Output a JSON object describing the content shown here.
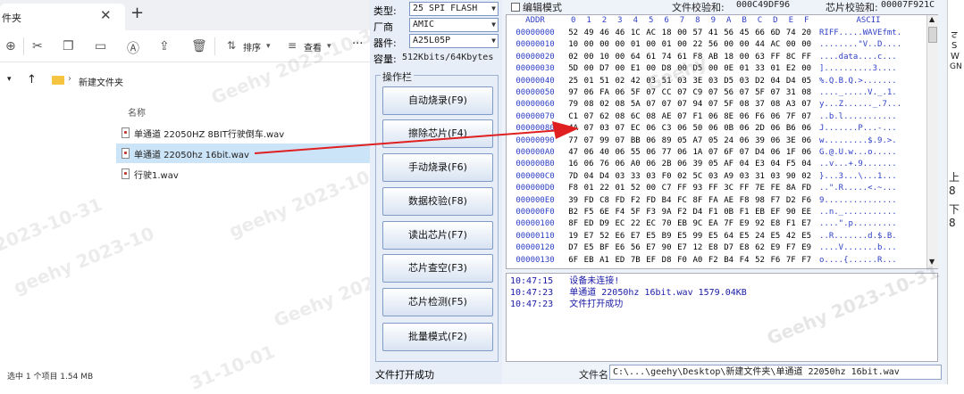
{
  "explorer": {
    "tab_title": "件夹",
    "tab_close": "✕",
    "tab_add": "+",
    "toolbar": {
      "sort_label": "排序",
      "view_label": "查看",
      "more": "···"
    },
    "address": {
      "folder": "新建文件夹"
    },
    "column_header": "名称",
    "files": [
      {
        "name": "单通道 22050HZ 8BIT行驶倒车.wav",
        "selected": false
      },
      {
        "name": "单通道 22050hz 16bit.wav",
        "selected": true
      },
      {
        "name": "行驶1.wav",
        "selected": false
      }
    ],
    "status": "选中 1 个项目  1.54 MB",
    "watermarks": [
      "Geehy 2023-10-31",
      "geehy 2023-10-31",
      "2023-10-31",
      "geehy 2023-10",
      "Geehy 2023-10-31",
      "31-10-01"
    ]
  },
  "programmer": {
    "type_label": "类型:",
    "type_value": "25 SPI FLASH",
    "vendor_label": "厂商",
    "vendor_value": "AMIC",
    "device_label": "器件:",
    "device_value": "A25L05P",
    "capacity_label": "容量:",
    "capacity_value": "512Kbits/64Kbytes",
    "group_title": "操作栏",
    "buttons": [
      "自动烧录(F9)",
      "擦除芯片(F4)",
      "手动烧录(F6)",
      "数据校验(F8)",
      "读出芯片(F7)",
      "芯片查空(F3)",
      "芯片检测(F5)",
      "批量模式(F2)"
    ],
    "edit_mode_label": "编辑模式",
    "file_checksum_label": "文件校验和:",
    "file_checksum_value": "000C49DF96",
    "chip_checksum_label": "芯片校验和:",
    "chip_checksum_value": "00007F921C",
    "hex_header": {
      "addr": "ADDR",
      "cols": [
        "0",
        "1",
        "2",
        "3",
        "4",
        "5",
        "6",
        "7",
        "8",
        "9",
        "A",
        "B",
        "C",
        "D",
        "E",
        "F"
      ],
      "ascii": "ASCII"
    },
    "hex_rows": [
      {
        "addr": "00000000",
        "bytes": [
          "52",
          "49",
          "46",
          "46",
          "1C",
          "AC",
          "18",
          "00",
          "57",
          "41",
          "56",
          "45",
          "66",
          "6D",
          "74",
          "20"
        ],
        "ascii": "RIFF.....WAVEfmt."
      },
      {
        "addr": "00000010",
        "bytes": [
          "10",
          "00",
          "00",
          "00",
          "01",
          "00",
          "01",
          "00",
          "22",
          "56",
          "00",
          "00",
          "44",
          "AC",
          "00",
          "00"
        ],
        "ascii": "........\"V..D...."
      },
      {
        "addr": "00000020",
        "bytes": [
          "02",
          "00",
          "10",
          "00",
          "64",
          "61",
          "74",
          "61",
          "F8",
          "AB",
          "18",
          "00",
          "63",
          "FF",
          "8C",
          "FF"
        ],
        "ascii": "....data....c..."
      },
      {
        "addr": "00000030",
        "bytes": [
          "5D",
          "00",
          "D7",
          "00",
          "E1",
          "00",
          "D8",
          "00",
          "D5",
          "00",
          "0E",
          "01",
          "33",
          "01",
          "E2",
          "00"
        ],
        "ascii": "]..........3...."
      },
      {
        "addr": "00000040",
        "bytes": [
          "25",
          "01",
          "51",
          "02",
          "42",
          "03",
          "51",
          "03",
          "3E",
          "03",
          "D5",
          "03",
          "D2",
          "04",
          "D4",
          "05"
        ],
        "ascii": "%.Q.B.Q.>......."
      },
      {
        "addr": "00000050",
        "bytes": [
          "97",
          "06",
          "FA",
          "06",
          "5F",
          "07",
          "CC",
          "07",
          "C9",
          "07",
          "56",
          "07",
          "5F",
          "07",
          "31",
          "08"
        ],
        "ascii": "...._.....V._.1."
      },
      {
        "addr": "00000060",
        "bytes": [
          "79",
          "08",
          "02",
          "08",
          "5A",
          "07",
          "07",
          "07",
          "94",
          "07",
          "5F",
          "08",
          "37",
          "08",
          "A3",
          "07"
        ],
        "ascii": "y...Z......_.7..."
      },
      {
        "addr": "00000070",
        "bytes": [
          "C1",
          "07",
          "62",
          "08",
          "6C",
          "08",
          "AE",
          "07",
          "F1",
          "06",
          "8E",
          "06",
          "F6",
          "06",
          "7F",
          "07"
        ],
        "ascii": "..b.l..........."
      },
      {
        "addr": "00000080",
        "bytes": [
          "4A",
          "07",
          "03",
          "07",
          "EC",
          "06",
          "C3",
          "06",
          "50",
          "06",
          "0B",
          "06",
          "2D",
          "06",
          "B6",
          "06"
        ],
        "ascii": "J.......P...-..."
      },
      {
        "addr": "00000090",
        "bytes": [
          "77",
          "07",
          "99",
          "07",
          "BB",
          "06",
          "89",
          "05",
          "A7",
          "05",
          "24",
          "06",
          "39",
          "06",
          "3E",
          "06"
        ],
        "ascii": "w.........$.9.>."
      },
      {
        "addr": "000000A0",
        "bytes": [
          "47",
          "06",
          "40",
          "06",
          "55",
          "06",
          "77",
          "06",
          "1A",
          "07",
          "6F",
          "07",
          "D4",
          "06",
          "1F",
          "06"
        ],
        "ascii": "G.@.U.w...o....."
      },
      {
        "addr": "000000B0",
        "bytes": [
          "16",
          "06",
          "76",
          "06",
          "A0",
          "06",
          "2B",
          "06",
          "39",
          "05",
          "AF",
          "04",
          "E3",
          "04",
          "F5",
          "04"
        ],
        "ascii": "..v...+.9......."
      },
      {
        "addr": "000000C0",
        "bytes": [
          "7D",
          "04",
          "D4",
          "03",
          "33",
          "03",
          "F0",
          "02",
          "5C",
          "03",
          "A9",
          "03",
          "31",
          "03",
          "90",
          "02"
        ],
        "ascii": "}...3...\\...1..."
      },
      {
        "addr": "000000D0",
        "bytes": [
          "F8",
          "01",
          "22",
          "01",
          "52",
          "00",
          "C7",
          "FF",
          "93",
          "FF",
          "3C",
          "FF",
          "7E",
          "FE",
          "8A",
          "FD"
        ],
        "ascii": "..\".R.....<.~..."
      },
      {
        "addr": "000000E0",
        "bytes": [
          "39",
          "FD",
          "C8",
          "FD",
          "F2",
          "FD",
          "B4",
          "FC",
          "8F",
          "FA",
          "AE",
          "F8",
          "98",
          "F7",
          "D2",
          "F6"
        ],
        "ascii": "9..............."
      },
      {
        "addr": "000000F0",
        "bytes": [
          "B2",
          "F5",
          "6E",
          "F4",
          "5F",
          "F3",
          "9A",
          "F2",
          "D4",
          "F1",
          "0B",
          "F1",
          "EB",
          "EF",
          "90",
          "EE"
        ],
        "ascii": "..n._..........."
      },
      {
        "addr": "00000100",
        "bytes": [
          "8F",
          "ED",
          "D9",
          "EC",
          "22",
          "EC",
          "70",
          "EB",
          "9C",
          "EA",
          "7F",
          "E9",
          "92",
          "E8",
          "F1",
          "E7"
        ],
        "ascii": "....\".p........."
      },
      {
        "addr": "00000110",
        "bytes": [
          "19",
          "E7",
          "52",
          "E6",
          "E7",
          "E5",
          "B9",
          "E5",
          "99",
          "E5",
          "64",
          "E5",
          "24",
          "E5",
          "42",
          "E5"
        ],
        "ascii": "..R.......d.$.B."
      },
      {
        "addr": "00000120",
        "bytes": [
          "D7",
          "E5",
          "BF",
          "E6",
          "56",
          "E7",
          "90",
          "E7",
          "12",
          "E8",
          "D7",
          "E8",
          "62",
          "E9",
          "F7",
          "E9"
        ],
        "ascii": "....V.......b..."
      },
      {
        "addr": "00000130",
        "bytes": [
          "6F",
          "EB",
          "A1",
          "ED",
          "7B",
          "EF",
          "D8",
          "F0",
          "A0",
          "F2",
          "B4",
          "F4",
          "52",
          "F6",
          "7F",
          "F7"
        ],
        "ascii": "o....{......R..."
      }
    ],
    "log": [
      {
        "time": "10:47:15",
        "msg": "设备未连接!"
      },
      {
        "time": "10:47:23",
        "msg": "单通道 22050hz 16bit.wav 1579.04KB"
      },
      {
        "time": "10:47:23",
        "msg": "文件打开成功"
      }
    ],
    "status": "文件打开成功",
    "filename_label": "文件名:",
    "filename_value": "C:\\...\\geehy\\Desktop\\新建文件夹\\单通道 22050hz 16bit.wav",
    "watermarks": [
      "Geehy",
      "Geehy 2023-10-31"
    ]
  },
  "sliver": {
    "lines": [
      "ਟ",
      "S",
      "W",
      "GN",
      "上8",
      "下8"
    ]
  },
  "colors": {
    "accent_blue": "#5a8cd8",
    "hex_blue": "#2c3ec6",
    "arrow_red": "#e02020",
    "selection": "#cce4f7"
  }
}
